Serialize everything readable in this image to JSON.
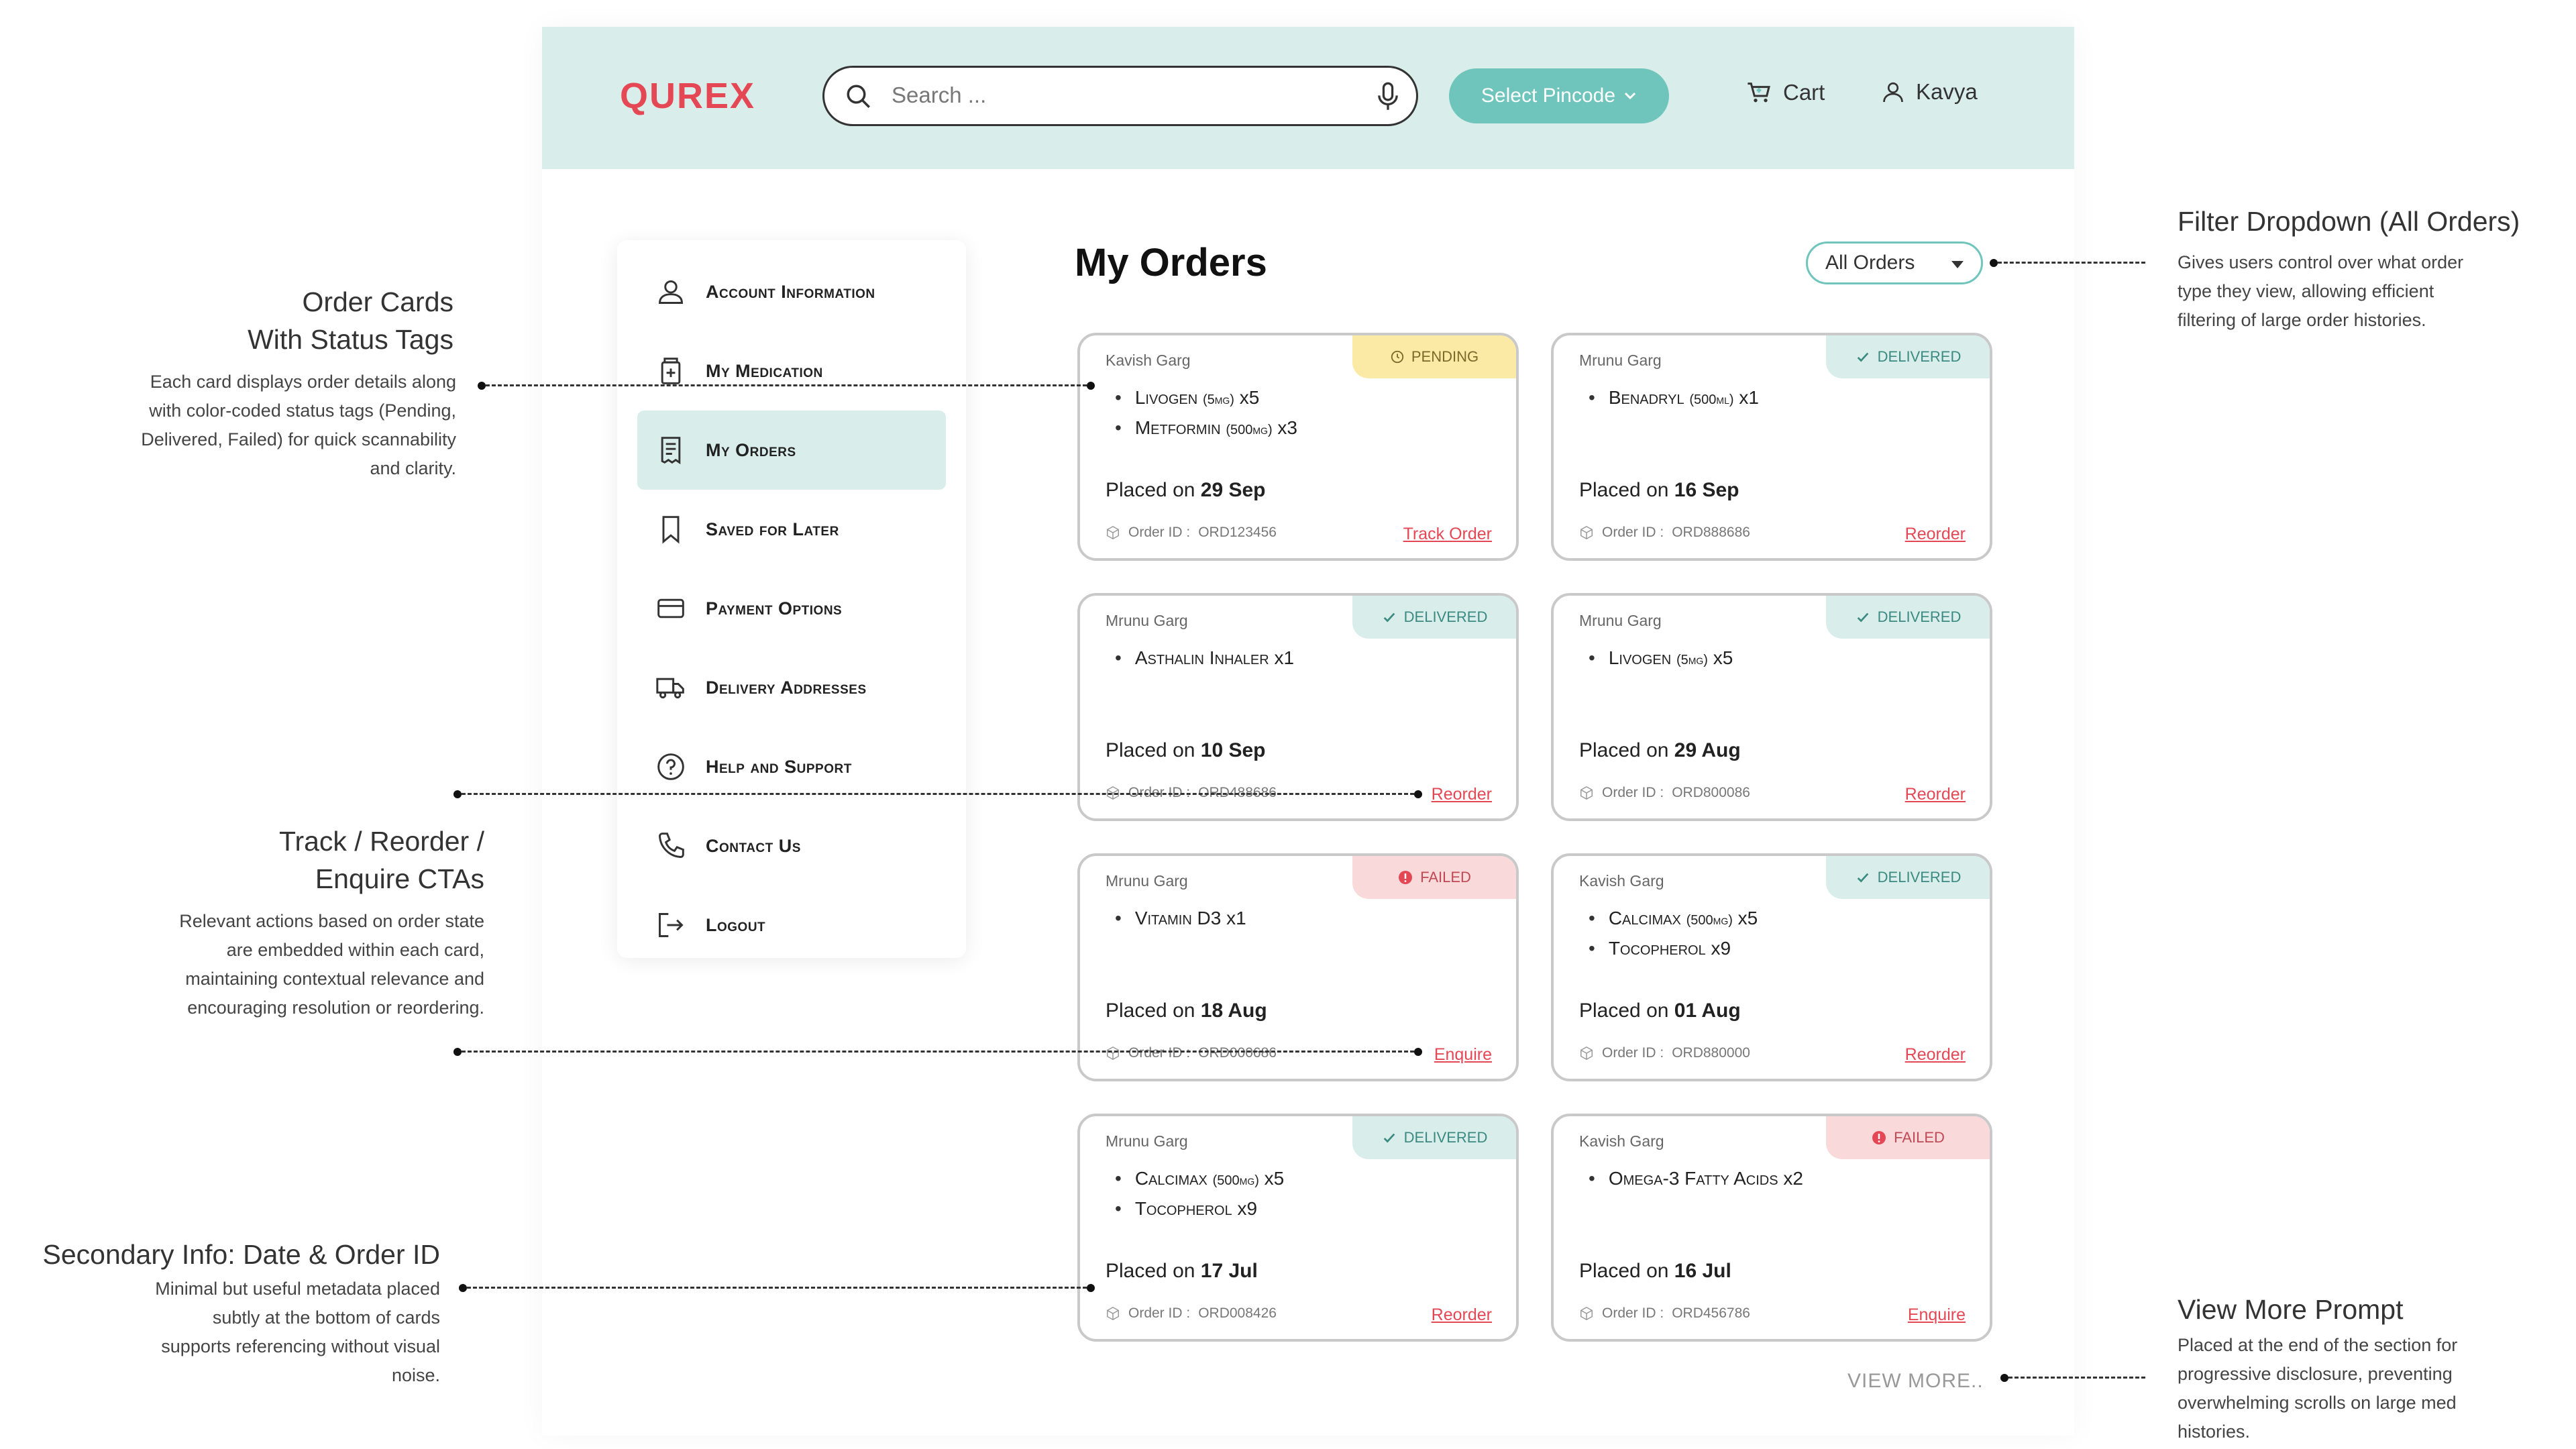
{
  "header": {
    "logo": "QUREX",
    "search_placeholder": "Search ...",
    "pincode_label": "Select Pincode",
    "cart_label": "Cart",
    "user_name": "Kavya"
  },
  "sidebar": {
    "items": [
      {
        "label": "Account Information",
        "icon": "user-icon"
      },
      {
        "label": "My Medication",
        "icon": "medication-icon"
      },
      {
        "label": "My Orders",
        "icon": "orders-icon"
      },
      {
        "label": "Saved for Later",
        "icon": "bookmark-icon"
      },
      {
        "label": "Payment Options",
        "icon": "card-icon"
      },
      {
        "label": "Delivery Addresses",
        "icon": "truck-icon"
      },
      {
        "label": "Help and Support",
        "icon": "help-icon"
      },
      {
        "label": "Contact Us",
        "icon": "phone-icon"
      },
      {
        "label": "Logout",
        "icon": "logout-icon"
      }
    ],
    "active_index": 2
  },
  "main": {
    "title": "My Orders",
    "filter_value": "All Orders",
    "placed_prefix": "Placed on",
    "order_id_prefix": "Order ID :",
    "view_more": "VIEW MORE.."
  },
  "orders": [
    {
      "name": "Kavish Garg",
      "status": "PENDING",
      "status_type": "pending",
      "items": [
        {
          "n": "Livogen",
          "d": "(5mg)",
          "q": "x5"
        },
        {
          "n": "Metformin",
          "d": "(500mg)",
          "q": "x3"
        }
      ],
      "date": "29 Sep",
      "order_id": "ORD123456",
      "cta": "Track Order"
    },
    {
      "name": "Mrunu Garg",
      "status": "DELIVERED",
      "status_type": "delivered",
      "items": [
        {
          "n": "Benadryl",
          "d": "(500ml)",
          "q": "x1"
        }
      ],
      "date": "16 Sep",
      "order_id": "ORD888686",
      "cta": "Reorder"
    },
    {
      "name": "Mrunu Garg",
      "status": "DELIVERED",
      "status_type": "delivered",
      "items": [
        {
          "n": "Asthalin Inhaler",
          "d": "",
          "q": "x1"
        }
      ],
      "date": "10 Sep",
      "order_id": "ORD488686",
      "cta": "Reorder"
    },
    {
      "name": "Mrunu Garg",
      "status": "DELIVERED",
      "status_type": "delivered",
      "items": [
        {
          "n": "Livogen",
          "d": "(5mg)",
          "q": "x5"
        }
      ],
      "date": "29 Aug",
      "order_id": "ORD800086",
      "cta": "Reorder"
    },
    {
      "name": "Mrunu Garg",
      "status": "FAILED",
      "status_type": "failed",
      "items": [
        {
          "n": "Vitamin D3",
          "d": "",
          "q": "x1"
        }
      ],
      "date": "18 Aug",
      "order_id": "ORD000686",
      "cta": "Enquire"
    },
    {
      "name": "Kavish Garg",
      "status": "DELIVERED",
      "status_type": "delivered",
      "items": [
        {
          "n": "Calcimax",
          "d": "(500mg)",
          "q": "x5"
        },
        {
          "n": "Tocopherol",
          "d": "",
          "q": "x9"
        }
      ],
      "date": "01 Aug",
      "order_id": "ORD880000",
      "cta": "Reorder"
    },
    {
      "name": "Mrunu Garg",
      "status": "DELIVERED",
      "status_type": "delivered",
      "items": [
        {
          "n": "Calcimax",
          "d": "(500mg)",
          "q": "x5"
        },
        {
          "n": "Tocopherol",
          "d": "",
          "q": "x9"
        }
      ],
      "date": "17 Jul",
      "order_id": "ORD008426",
      "cta": "Reorder"
    },
    {
      "name": "Kavish Garg",
      "status": "FAILED",
      "status_type": "failed",
      "items": [
        {
          "n": "Omega-3 Fatty Acids",
          "d": "",
          "q": "x2"
        }
      ],
      "date": "16 Jul",
      "order_id": "ORD456786",
      "cta": "Enquire"
    }
  ],
  "annotations": {
    "order_cards": {
      "title1": "Order Cards",
      "title2": "With Status Tags",
      "body": [
        "Each card displays order details along",
        "with color-coded status tags (Pending,",
        "Delivered, Failed) for quick scannability",
        "and clarity."
      ]
    },
    "ctas": {
      "title1": "Track / Reorder /",
      "title2": "Enquire CTAs",
      "body": [
        "Relevant actions based on order state",
        "are embedded within each card,",
        "maintaining contextual relevance and",
        "encouraging resolution or reordering."
      ]
    },
    "secondary": {
      "title": "Secondary Info: Date & Order ID",
      "body": [
        "Minimal but useful metadata placed",
        "subtly at the bottom of cards",
        "supports referencing without visual",
        "noise."
      ]
    },
    "filter": {
      "title": "Filter Dropdown (All Orders)",
      "body": [
        "Gives users control over what order",
        "type they view, allowing efficient",
        "filtering of large order histories."
      ]
    },
    "view_more": {
      "title": "View More Prompt",
      "body": [
        "Placed at the end of the section for",
        "progressive disclosure, preventing",
        "overwhelming scrolls on large med",
        "histories."
      ]
    }
  },
  "colors": {
    "brand": "#e54855",
    "accent": "#6fc5bb",
    "header_bg": "#d9eeeb",
    "pending": "#fbe9a6",
    "failed": "#f9d9da"
  }
}
